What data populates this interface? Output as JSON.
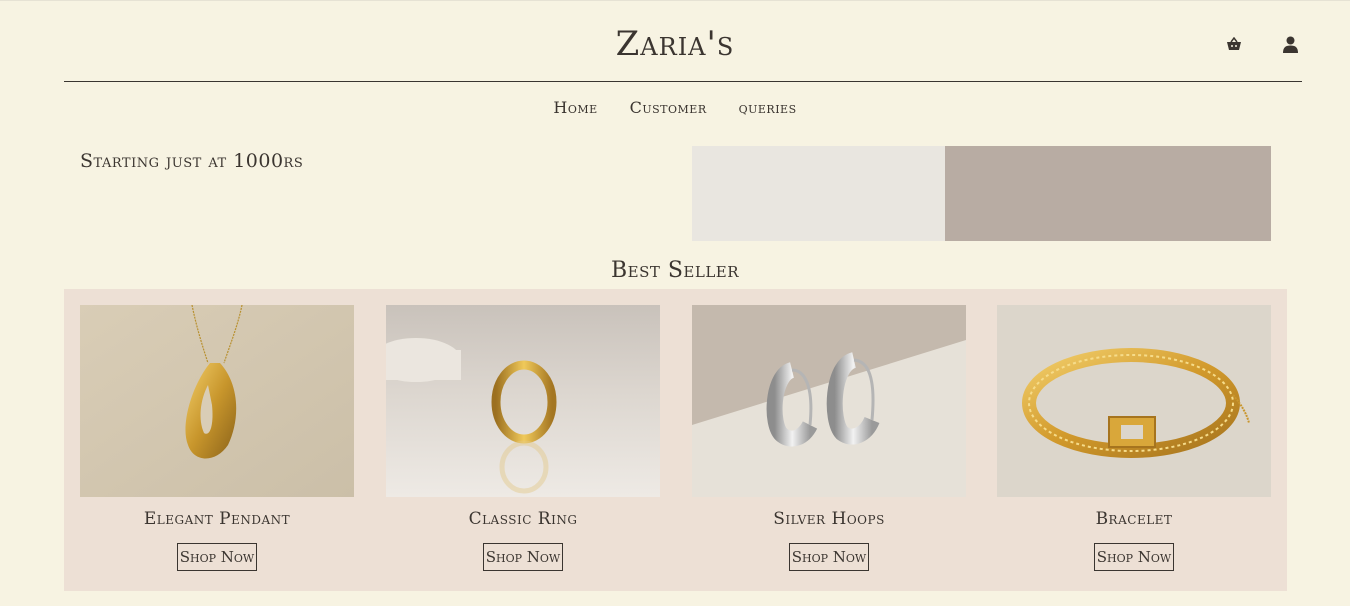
{
  "brand": "Zaria's",
  "header": {
    "icons": [
      "basket-icon",
      "user-icon"
    ]
  },
  "nav": {
    "items": [
      "Home",
      "Customer",
      "queries"
    ]
  },
  "promo": {
    "text": "Starting just at 1000rs"
  },
  "best_seller": {
    "title": "Best Seller",
    "products": [
      {
        "name": "Elegant Pendant",
        "button": "Shop Now"
      },
      {
        "name": "Classic Ring",
        "button": "Shop Now"
      },
      {
        "name": "Silver Hoops",
        "button": "Shop Now"
      },
      {
        "name": "Bracelet",
        "button": "Shop Now"
      }
    ]
  },
  "colors": {
    "background": "#f7f3e2",
    "panel": "#ede0d5",
    "text": "#3b3530",
    "gold": "#d4a437",
    "silver": "#c9c9c9"
  }
}
